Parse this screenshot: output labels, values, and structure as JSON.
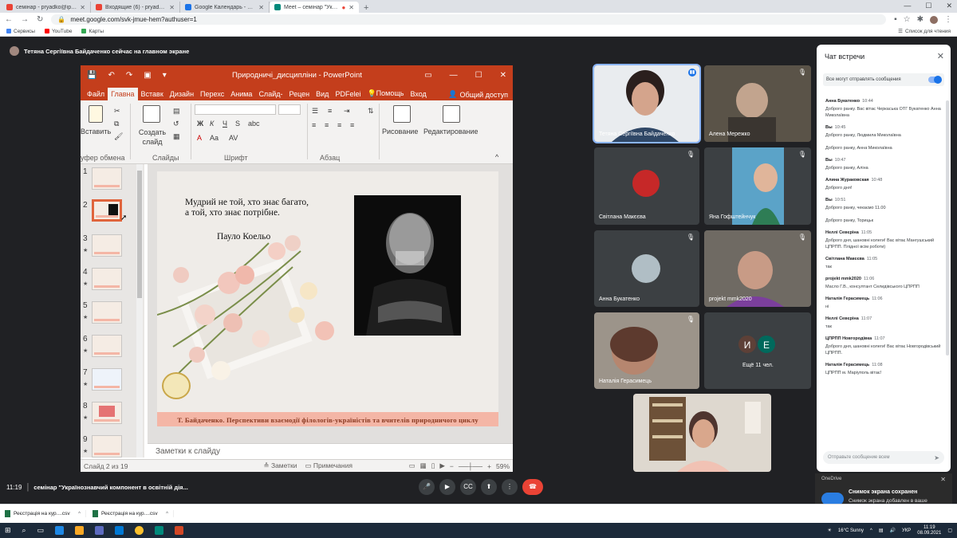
{
  "browser": {
    "tabs": [
      {
        "label": "семінар - pryadko@ippo.dn.ua",
        "color": "#ea4335"
      },
      {
        "label": "Входящие (6) - pryadkoIf77@gm",
        "color": "#ea4335"
      },
      {
        "label": "Google Календарь - среда, 8 се",
        "color": "#1a73e8"
      },
      {
        "label": "Meet – семінар \"Українознав",
        "color": "#00897b"
      }
    ],
    "url": "meet.google.com/svk-jmue-hem?authuser=1",
    "bookmarks": [
      "Сервисы",
      "YouTube",
      "Карты"
    ],
    "reading_list": "Список для чтения"
  },
  "meet": {
    "presenting_banner": "Тетяна Сергіївна Байдаченко сейчас на главном экране",
    "time": "11:19",
    "meeting_title": "семінар \"Українознавчий компонент в освітній дія...",
    "participants": [
      "Тетяна Сергіївна Байдаченко",
      "Алена Мережко",
      "Світлана Макєєва",
      "Яна Гофштейнчук",
      "Анна Букатенко",
      "projekt mmk2020",
      "Наталія Герасимець",
      "Ещё 11 чел."
    ],
    "more_initials": [
      "И",
      "Е"
    ]
  },
  "ppt": {
    "title": "Природничі_дисципліни - PowerPoint",
    "tabs": [
      "Файл",
      "Главна",
      "Вставк",
      "Дизайн",
      "Перехс",
      "Анима",
      "Слайд-",
      "Рецен",
      "Вид",
      "PDFelei",
      "Помощь",
      "Вход"
    ],
    "share": "Общий доступ",
    "ribbon": {
      "paste": "Вставить",
      "clipboard": "уфер обмена",
      "new_slide": "Создать слайд",
      "slides": "Слайды",
      "font": "Шрифт",
      "paragraph": "Абзац",
      "drawing": "Рисование",
      "editing": "Редактирование"
    },
    "slide": {
      "quote": "Мудрий не той, хто знає багато, а той, хто знає потрібне.",
      "author": "Пауло Коельо",
      "footer": "Т. Байдаченко. Перспективи взаємодії філологів-україністів та вчителів природничого циклу"
    },
    "thumb_numbers": [
      "1",
      "2",
      "3",
      "4",
      "5",
      "6",
      "7",
      "8",
      "9"
    ],
    "notes": "Заметки к слайду",
    "status": {
      "slide": "Слайд 2 из 19",
      "notes_btn": "Заметки",
      "comments_btn": "Примечания",
      "zoom": "59%"
    }
  },
  "chat": {
    "title": "Чат встречи",
    "allow": "Все могут отправлять сообщения",
    "placeholder": "Отправьте сообщение всем",
    "messages": [
      {
        "who": "Анна Букатенко",
        "time": "10:44",
        "text": "Доброго ранку. Вас вітає Черкаська ОТГ Букатенко Анна Миколаївна"
      },
      {
        "who": "Вы",
        "time": "10:45",
        "text": "Доброго ранку, Людмила Миколаївна"
      },
      {
        "who": "",
        "time": "",
        "text": "Доброго ранку, Анна Миколаївна"
      },
      {
        "who": "Вы",
        "time": "10:47",
        "text": "Доброго ранку, Аліна"
      },
      {
        "who": "Алина Жураковская",
        "time": "10:48",
        "text": "Доброго дня!"
      },
      {
        "who": "Вы",
        "time": "10:51",
        "text": "Доброго ранку, чекаємо 11.00"
      },
      {
        "who": "",
        "time": "",
        "text": "Доброго ранку, Торицьк"
      },
      {
        "who": "Неллі Севєріна",
        "time": "11:05",
        "text": "Доброго дня, шановні колеги! Вас вітає Мангушський ЦПРПП. Плідної всім роботи)"
      },
      {
        "who": "Світлана Макєєва",
        "time": "11:05",
        "text": "так"
      },
      {
        "who": "projekt mmk2020",
        "time": "11:06",
        "text": "Масло Г.В., консултант Селидівського ЦПРПП"
      },
      {
        "who": "Наталія Герасимець",
        "time": "11:06",
        "text": "ні"
      },
      {
        "who": "Неллі Севєріна",
        "time": "11:07",
        "text": "так"
      },
      {
        "who": "ЦПРПП Новгородівка",
        "time": "11:07",
        "text": "Доброго дня, шановні колеги! Вас вітає Новгородівський ЦПРПП."
      },
      {
        "who": "Наталія Герасимець",
        "time": "11:08",
        "text": "ЦПРПП м. Маріуполь вітає!"
      }
    ]
  },
  "notification": {
    "app": "OneDrive",
    "title": "Снимок экрана сохранен",
    "body": "Снимок экрана добавлен в ваше хранилище OneDrive."
  },
  "downloads": [
    "Реєстрація на кур....csv",
    "Реєстрація на кур....csv"
  ],
  "taskbar": {
    "weather": "16°C  Sunny",
    "lang": "УКР",
    "time": "11:19",
    "date": "08.09.2021"
  }
}
